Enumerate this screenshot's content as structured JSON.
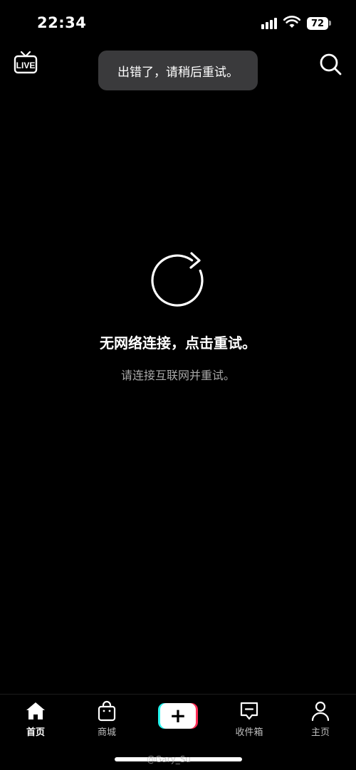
{
  "status_bar": {
    "time": "22:34",
    "battery": "72"
  },
  "top_bar": {
    "live_label": "LIVE",
    "live_icon": "live-tv-icon",
    "search_icon": "search-icon"
  },
  "toast": {
    "message": "出错了，请稍后重试。"
  },
  "main": {
    "refresh_icon": "refresh-icon",
    "title": "无网络连接，点击重试。",
    "subtitle": "请连接互联网并重试。"
  },
  "bottom_nav": {
    "items": [
      {
        "label": "首页",
        "icon": "home-icon",
        "active": true
      },
      {
        "label": "商城",
        "icon": "shopping-bag-icon",
        "active": false
      },
      {
        "label": "",
        "icon": "create-plus-icon",
        "active": false
      },
      {
        "label": "收件箱",
        "icon": "inbox-icon",
        "active": false
      },
      {
        "label": "主页",
        "icon": "profile-icon",
        "active": false
      }
    ],
    "create_symbol": "+"
  },
  "watermark": "@Gary_Su"
}
